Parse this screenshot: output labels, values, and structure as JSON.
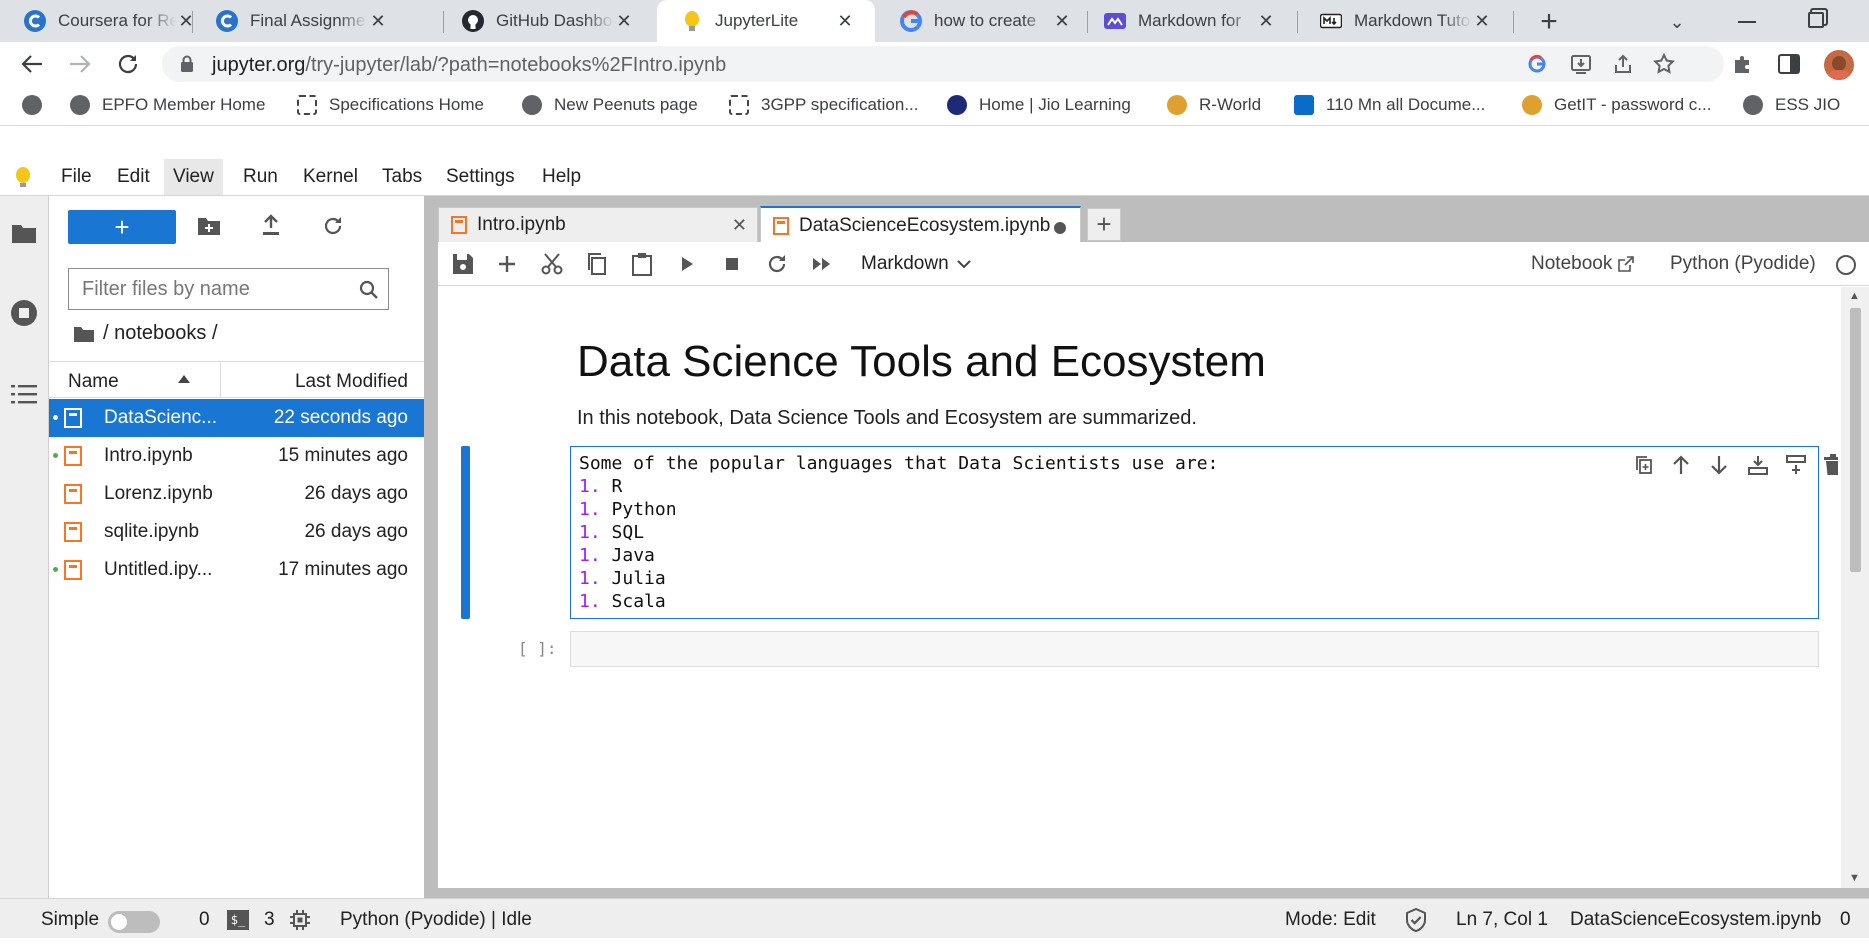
{
  "browser": {
    "tabs": [
      {
        "title": "Coursera for Re",
        "icon": "coursera-icon"
      },
      {
        "title": "Final Assignme",
        "icon": "coursera-icon"
      },
      {
        "title": "GitHub Dashbo",
        "icon": "github-icon"
      },
      {
        "title": "JupyterLite",
        "icon": "jupyterlite-icon",
        "active": true
      },
      {
        "title": "how to create",
        "icon": "google-icon"
      },
      {
        "title": "Markdown for",
        "icon": "markdown-guide-icon"
      },
      {
        "title": "Markdown Tuto",
        "icon": "markdown-icon"
      }
    ],
    "url_host": "jupyter.org",
    "url_path": "/try-jupyter/lab/?path=notebooks%2FIntro.ipynb",
    "bookmarks": [
      {
        "label": ""
      },
      {
        "label": "EPFO Member Home"
      },
      {
        "label": "Specifications Home"
      },
      {
        "label": "New Peenuts page"
      },
      {
        "label": "3GPP specification..."
      },
      {
        "label": "Home | Jio Learning"
      },
      {
        "label": "R-World"
      },
      {
        "label": "110 Mn all Docume..."
      },
      {
        "label": "GetIT - password c..."
      },
      {
        "label": "ESS JIO"
      }
    ]
  },
  "menubar": [
    "File",
    "Edit",
    "View",
    "Run",
    "Kernel",
    "Tabs",
    "Settings",
    "Help"
  ],
  "filebrowser": {
    "new_label": "+",
    "filter_placeholder": "Filter files by name",
    "breadcrumb": "/ notebooks /",
    "col_name": "Name",
    "col_modified": "Last Modified",
    "files": [
      {
        "name": "DataScienc...",
        "modified": "22 seconds ago",
        "selected": true,
        "running": true
      },
      {
        "name": "Intro.ipynb",
        "modified": "15 minutes ago",
        "running": true
      },
      {
        "name": "Lorenz.ipynb",
        "modified": "26 days ago"
      },
      {
        "name": "sqlite.ipynb",
        "modified": "26 days ago"
      },
      {
        "name": "Untitled.ipy...",
        "modified": "17 minutes ago",
        "running": true
      }
    ]
  },
  "notebook": {
    "tabs": [
      {
        "title": "Intro.ipynb"
      },
      {
        "title": "DataScienceEcosystem.ipynb",
        "active": true
      }
    ],
    "celltype": "Markdown",
    "open_in": "Notebook",
    "kernel": "Python (Pyodide)",
    "h1": "Data Science Tools and Ecosystem",
    "intro": "In this notebook, Data Science Tools and Ecosystem are summarized.",
    "edit_lines": [
      {
        "num": "",
        "text": "Some of the popular languages that Data Scientists use are:"
      },
      {
        "num": "1.",
        "text": " R"
      },
      {
        "num": "1.",
        "text": " Python"
      },
      {
        "num": "1.",
        "text": " SQL"
      },
      {
        "num": "1.",
        "text": " Java"
      },
      {
        "num": "1.",
        "text": " Julia"
      },
      {
        "num": "1.",
        "text": " Scala"
      }
    ],
    "prompt": "[ ]:"
  },
  "status": {
    "simple": "Simple",
    "terminals": "0",
    "kernels": "3",
    "kernel_status": "Python (Pyodide) | Idle",
    "mode": "Mode: Edit",
    "position": "Ln 7, Col 1",
    "filename": "DataScienceEcosystem.ipynb",
    "notifications": "0"
  },
  "colors": {
    "accent": "#1976d2",
    "jupyter_orange": "#f37726",
    "list_number": "#a020f0"
  }
}
